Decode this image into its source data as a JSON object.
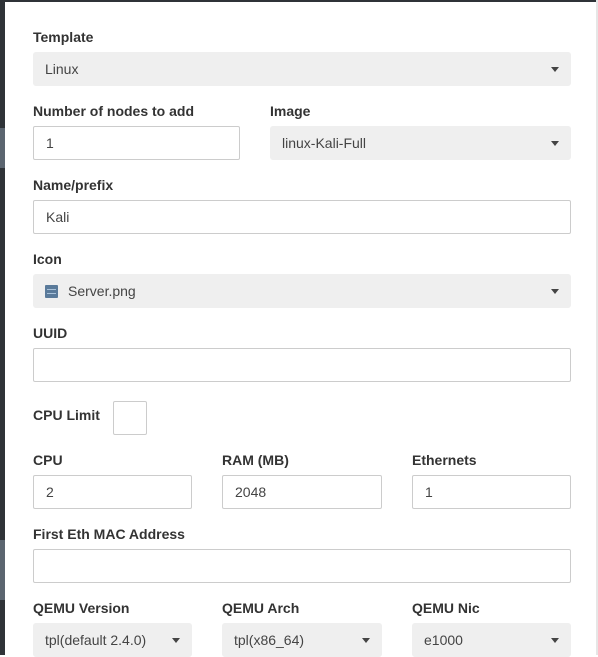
{
  "form": {
    "template": {
      "label": "Template",
      "value": "Linux"
    },
    "nodes": {
      "label": "Number of nodes to add",
      "value": "1"
    },
    "image": {
      "label": "Image",
      "value": "linux-Kali-Full"
    },
    "name": {
      "label": "Name/prefix",
      "value": "Kali"
    },
    "icon": {
      "label": "Icon",
      "value": "Server.png",
      "icon_name": "server-icon"
    },
    "uuid": {
      "label": "UUID",
      "value": ""
    },
    "cpu_limit": {
      "label": "CPU Limit",
      "checked": false
    },
    "cpu": {
      "label": "CPU",
      "value": "2"
    },
    "ram": {
      "label": "RAM (MB)",
      "value": "2048"
    },
    "ethernets": {
      "label": "Ethernets",
      "value": "1"
    },
    "mac": {
      "label": "First Eth MAC Address",
      "value": ""
    },
    "qemu_version": {
      "label": "QEMU Version",
      "value": "tpl(default 2.4.0)"
    },
    "qemu_arch": {
      "label": "QEMU Arch",
      "value": "tpl(x86_64)"
    },
    "qemu_nic": {
      "label": "QEMU Nic",
      "value": "e1000"
    }
  }
}
